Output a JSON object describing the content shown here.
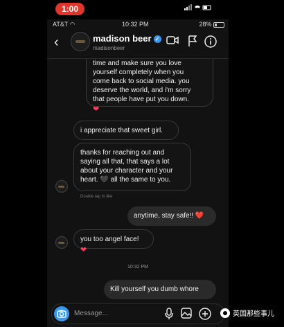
{
  "recording": {
    "time": "1:00"
  },
  "status": {
    "carrier": "AT&T",
    "time": "10:32 PM",
    "battery": "28%"
  },
  "header": {
    "name": "madison beer",
    "handle": "madisonbeer"
  },
  "messages": [
    {
      "text": "time and make sure you love\nyourself completely when you\ncome back to social media. you\ndeserve the world, and i'm sorry\nthat people have put you down."
    },
    {
      "text": "i appreciate that sweet girl."
    },
    {
      "text": "thanks for reaching out and\nsaying all that, that says a lot\nabout your character and your\nheart. 🖤 all the same to you."
    },
    {
      "text": "anytime, stay safe!! ❤️"
    },
    {
      "text": "you too angel face!"
    },
    {
      "text": "Kill yourself you dumb whore"
    }
  ],
  "double_tap_hint": "Double tap to like",
  "timestamp": "10:32 PM",
  "composer": {
    "placeholder": "Message..."
  },
  "watermark": "英国那些事儿",
  "colors": {
    "recording": "#e0352b",
    "verified": "#3897f0",
    "heart": "#ff3b5c",
    "camera": "#3897f0"
  }
}
